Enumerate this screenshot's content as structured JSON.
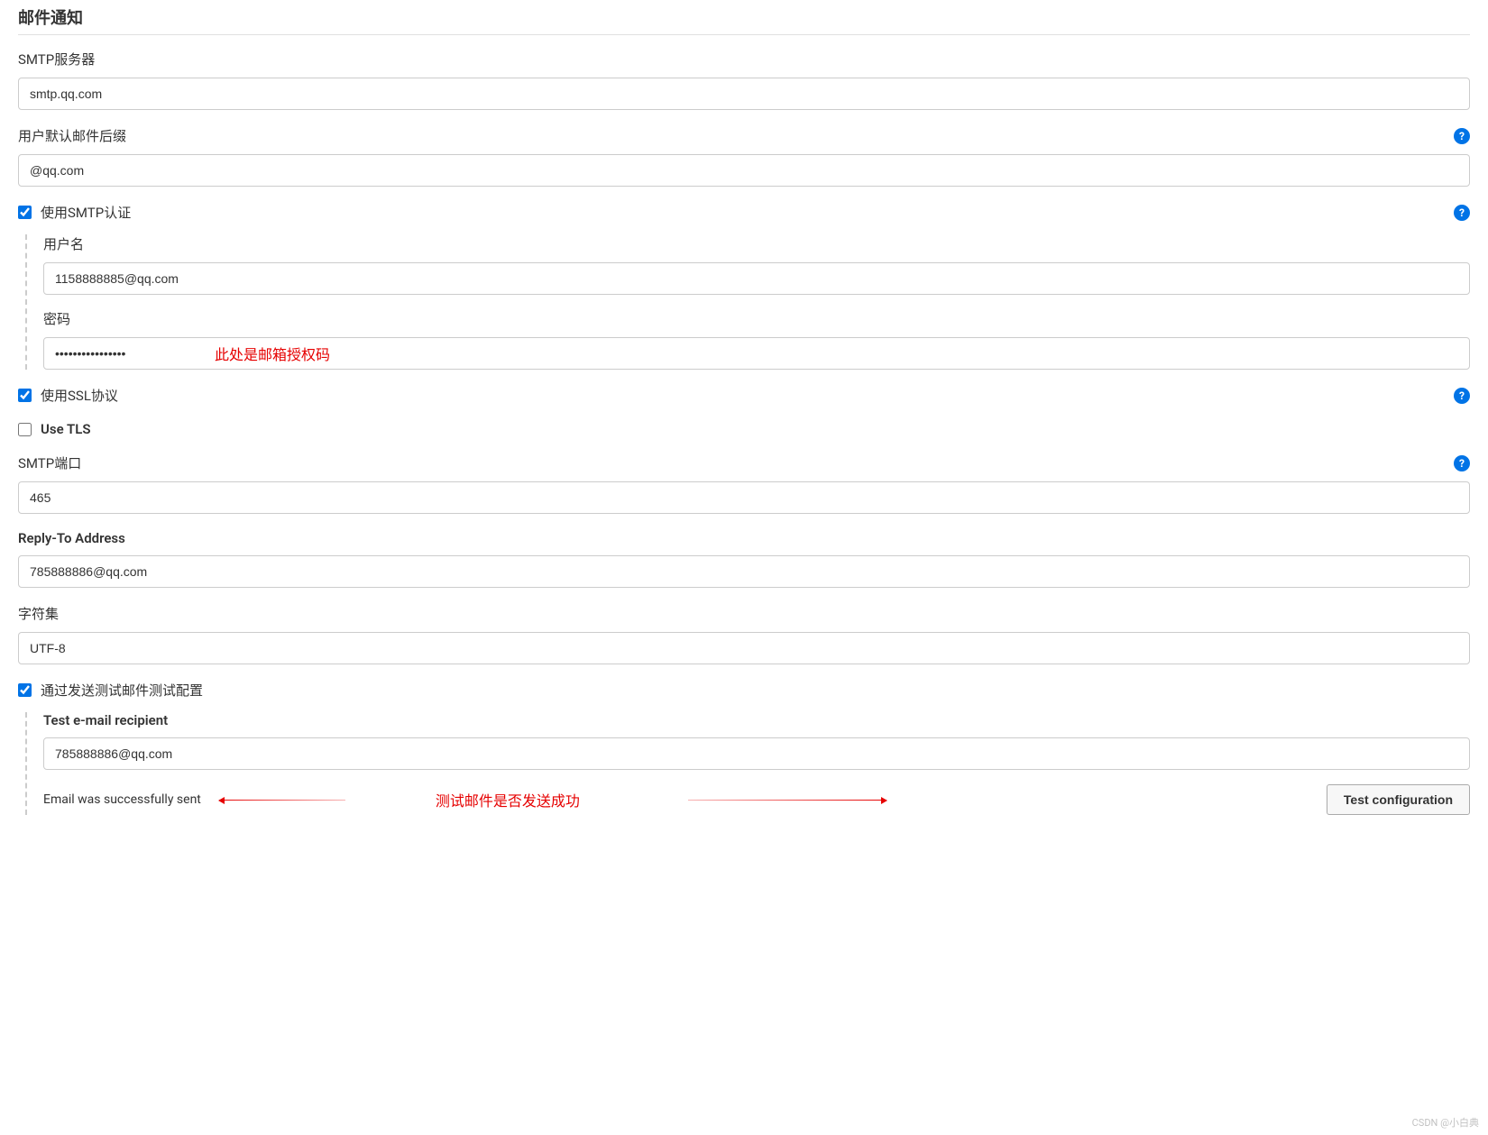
{
  "section": {
    "title": "邮件通知"
  },
  "smtp_server": {
    "label": "SMTP服务器",
    "value": "smtp.qq.com"
  },
  "default_suffix": {
    "label": "用户默认邮件后缀",
    "value": "@qq.com"
  },
  "smtp_auth": {
    "label": "使用SMTP认证",
    "checked": true,
    "username": {
      "label": "用户名",
      "value": "1158888885@qq.com"
    },
    "password": {
      "label": "密码",
      "value": "••••••••••••••••",
      "annotation": "此处是邮箱授权码"
    }
  },
  "use_ssl": {
    "label": "使用SSL协议",
    "checked": true
  },
  "use_tls": {
    "label": "Use TLS",
    "checked": false
  },
  "smtp_port": {
    "label": "SMTP端口",
    "value": "465"
  },
  "reply_to": {
    "label": "Reply-To Address",
    "value": "785888886@qq.com"
  },
  "charset": {
    "label": "字符集",
    "value": "UTF-8"
  },
  "test_config": {
    "label": "通过发送测试邮件测试配置",
    "checked": true,
    "recipient": {
      "label": "Test e-mail recipient",
      "value": "785888886@qq.com"
    },
    "status": "Email was successfully sent",
    "annotation": "测试邮件是否发送成功",
    "button": "Test configuration"
  },
  "watermark": "CSDN @小白典"
}
